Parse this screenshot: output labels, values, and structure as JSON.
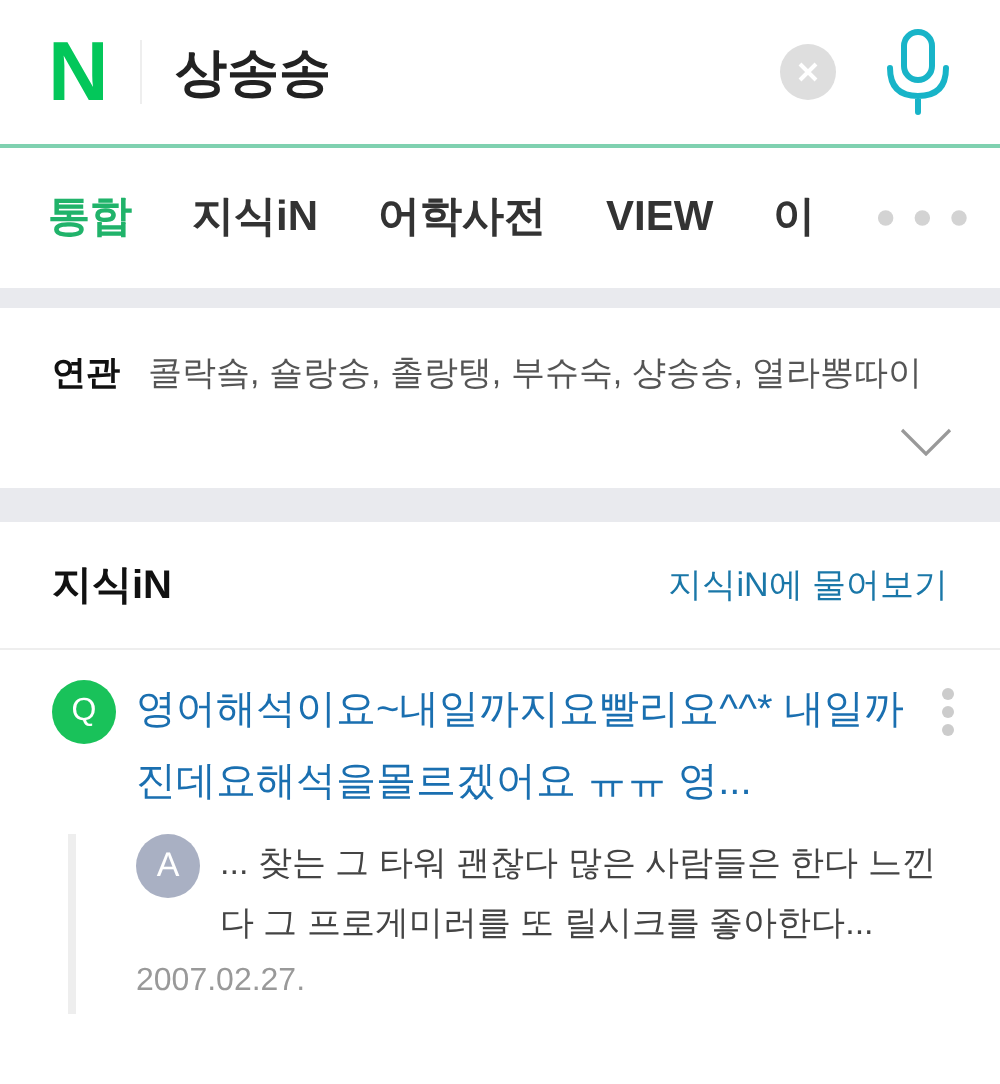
{
  "search": {
    "logo": "N",
    "query": "상송송"
  },
  "tabs": [
    {
      "label": "통합",
      "selected": true
    },
    {
      "label": "지식iN",
      "selected": false
    },
    {
      "label": "어학사전",
      "selected": false
    },
    {
      "label": "VIEW",
      "selected": false
    },
    {
      "label": "이",
      "selected": false
    }
  ],
  "related": {
    "label": "연관",
    "terms": "콜락숔, 숄랑송, 촐랑탱, 부슈숙, 샹송송, 열라뽕따이"
  },
  "kin": {
    "title": "지식iN",
    "ask_link": "지식iN에 물어보기",
    "results": [
      {
        "q_badge": "Q",
        "question": "영어해석이요~내일까지요빨리요^^* 내일까진데요해석을몰르겠어요 ㅠㅠ 영...",
        "a_badge": "A",
        "answer": "... 찾는 그 타워 괜찮다 많은 사람들은 한다 느낀다 그 프로게미러를 또 릴시크를 좋아한다...",
        "date": "2007.02.27."
      }
    ]
  }
}
